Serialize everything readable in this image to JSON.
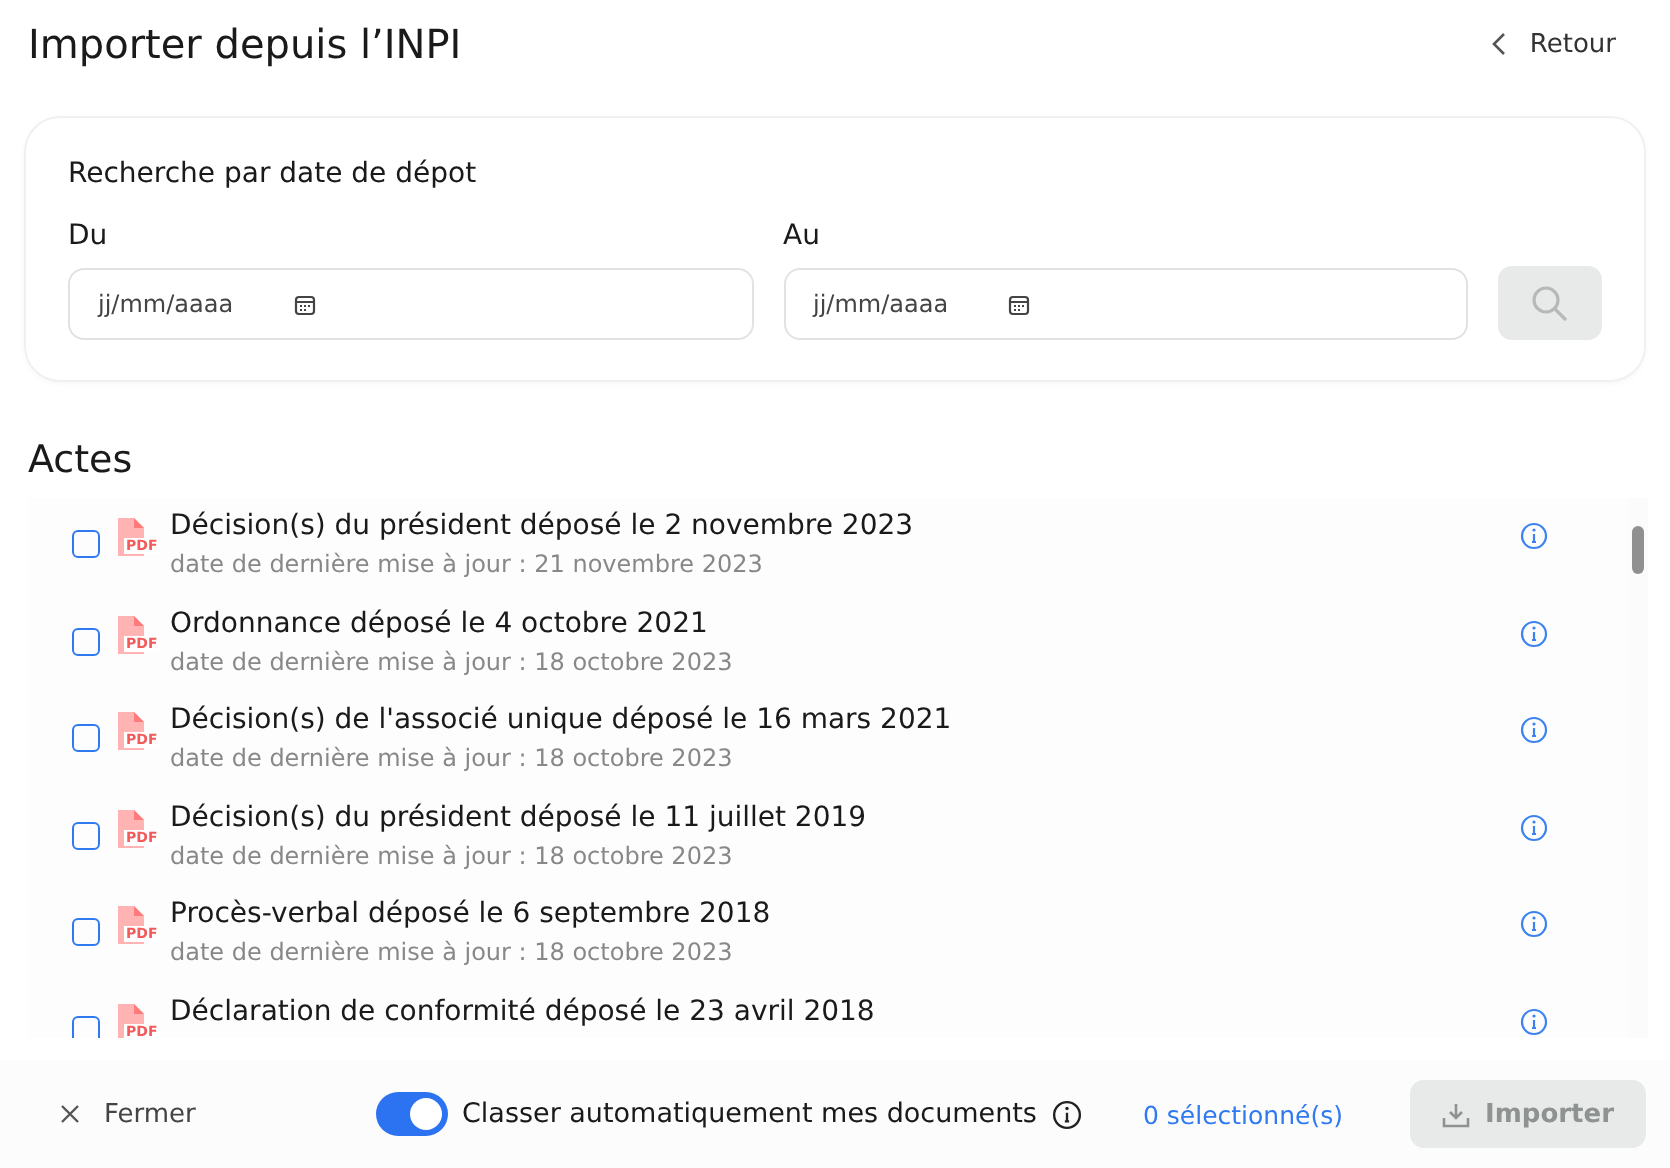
{
  "header": {
    "title": "Importer depuis l’INPI",
    "back": "Retour"
  },
  "search": {
    "heading": "Recherche par date de dépot",
    "from": {
      "label": "Du",
      "placeholder": "jj/mm/aaaa"
    },
    "to": {
      "label": "Au",
      "placeholder": "jj/mm/aaaa"
    },
    "button_disabled": true
  },
  "section_title": "Actes",
  "documents": [
    {
      "title": "Décision(s) du président déposé le 2 novembre 2023",
      "updated": "date de dernière mise à jour : 21 novembre 2023",
      "checked": false,
      "type_label": "PDF"
    },
    {
      "title": "Ordonnance déposé le 4 octobre 2021",
      "updated": "date de dernière mise à jour : 18 octobre 2023",
      "checked": false,
      "type_label": "PDF"
    },
    {
      "title": "Décision(s) de l'associé unique déposé le 16 mars 2021",
      "updated": "date de dernière mise à jour : 18 octobre 2023",
      "checked": false,
      "type_label": "PDF"
    },
    {
      "title": "Décision(s) du président déposé le 11 juillet 2019",
      "updated": "date de dernière mise à jour : 18 octobre 2023",
      "checked": false,
      "type_label": "PDF"
    },
    {
      "title": "Procès-verbal déposé le 6 septembre 2018",
      "updated": "date de dernière mise à jour : 18 octobre 2023",
      "checked": false,
      "type_label": "PDF"
    },
    {
      "title": "Déclaration de conformité déposé le 23 avril 2018",
      "checked": false,
      "type_label": "PDF"
    }
  ],
  "footer": {
    "close": "Fermer",
    "auto_classify": {
      "label": "Classer automatiquement mes documents",
      "on": true
    },
    "selected_count": "0 sélectionné(s)",
    "import": {
      "label": "Importer",
      "disabled": true
    }
  }
}
